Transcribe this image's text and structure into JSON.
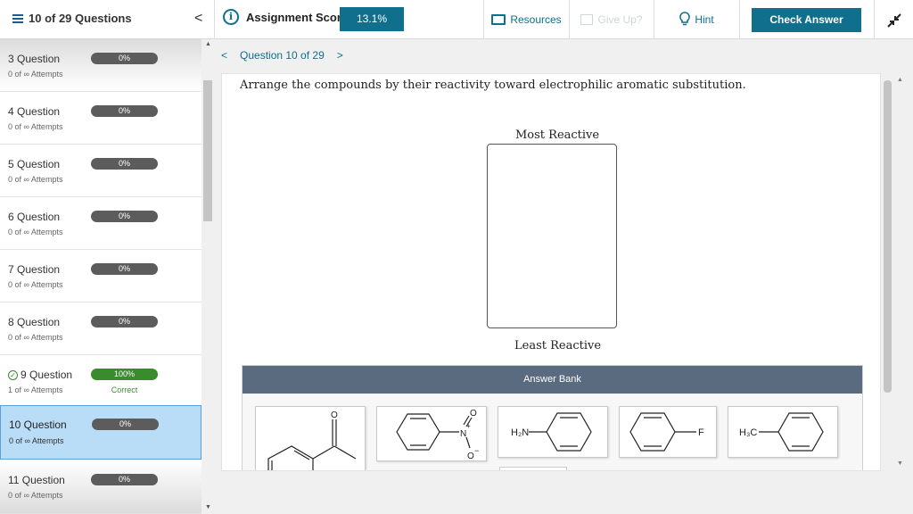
{
  "header": {
    "question_count": "10 of 29 Questions",
    "score_label": "Assignment Score:",
    "score_value": "13.1%",
    "resources_label": "Resources",
    "giveup_label": "Give Up?",
    "hint_label": "Hint",
    "check_label": "Check Answer",
    "collapse_glyph": "<",
    "info_glyph": "i"
  },
  "sidebar": {
    "items": [
      {
        "title": "3 Question",
        "attempts": "0 of ∞ Attempts",
        "progress": "0%"
      },
      {
        "title": "4 Question",
        "attempts": "0 of ∞ Attempts",
        "progress": "0%"
      },
      {
        "title": "5 Question",
        "attempts": "0 of ∞ Attempts",
        "progress": "0%"
      },
      {
        "title": "6 Question",
        "attempts": "0 of ∞ Attempts",
        "progress": "0%"
      },
      {
        "title": "7 Question",
        "attempts": "0 of ∞ Attempts",
        "progress": "0%"
      },
      {
        "title": "8 Question",
        "attempts": "0 of ∞ Attempts",
        "progress": "0%"
      },
      {
        "title": "9 Question",
        "attempts": "1 of ∞ Attempts",
        "progress": "100%",
        "status": "Correct"
      },
      {
        "title": "10 Question",
        "attempts": "0 of ∞ Attempts",
        "progress": "0%"
      },
      {
        "title": "11 Question",
        "attempts": "0 of ∞ Attempts",
        "progress": "0%"
      }
    ]
  },
  "question": {
    "nav_label": "Question 10 of 29",
    "prev_glyph": "<",
    "next_glyph": ">",
    "prompt": "Arrange the compounds by their reactivity toward electrophilic aromatic substitution.",
    "most_label": "Most Reactive",
    "least_label": "Least Reactive",
    "bank_title": "Answer Bank",
    "cards": [
      {
        "name": "acetophenone-like"
      },
      {
        "name": "nitrobenzene",
        "labels": {
          "n": "N",
          "plus": "+",
          "o_top": "O",
          "o_bot": "O",
          "minus": "−"
        }
      },
      {
        "name": "aniline",
        "labels": {
          "group": "H₂N"
        }
      },
      {
        "name": "fluorobenzene",
        "labels": {
          "group": "F"
        }
      },
      {
        "name": "toluene",
        "labels": {
          "group": "H₃C"
        }
      }
    ]
  }
}
